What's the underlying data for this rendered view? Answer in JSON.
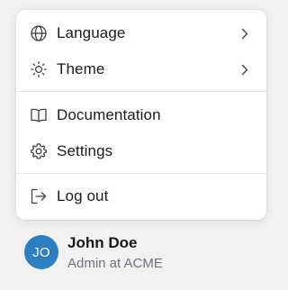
{
  "menu": {
    "items": [
      {
        "label": "Language",
        "icon": "globe-icon",
        "has_submenu": true
      },
      {
        "label": "Theme",
        "icon": "sun-icon",
        "has_submenu": true
      },
      {
        "label": "Documentation",
        "icon": "book-icon",
        "has_submenu": false
      },
      {
        "label": "Settings",
        "icon": "gear-icon",
        "has_submenu": false
      },
      {
        "label": "Log out",
        "icon": "log-out-icon",
        "has_submenu": false
      }
    ]
  },
  "user": {
    "initials": "JO",
    "name": "John Doe",
    "role": "Admin at ACME"
  },
  "colors": {
    "avatar_bg": "#2e7fc0",
    "text": "#1b1b1f",
    "muted_text": "#717179",
    "divider": "#e4e4e7",
    "page_bg": "#f1f1f2"
  }
}
